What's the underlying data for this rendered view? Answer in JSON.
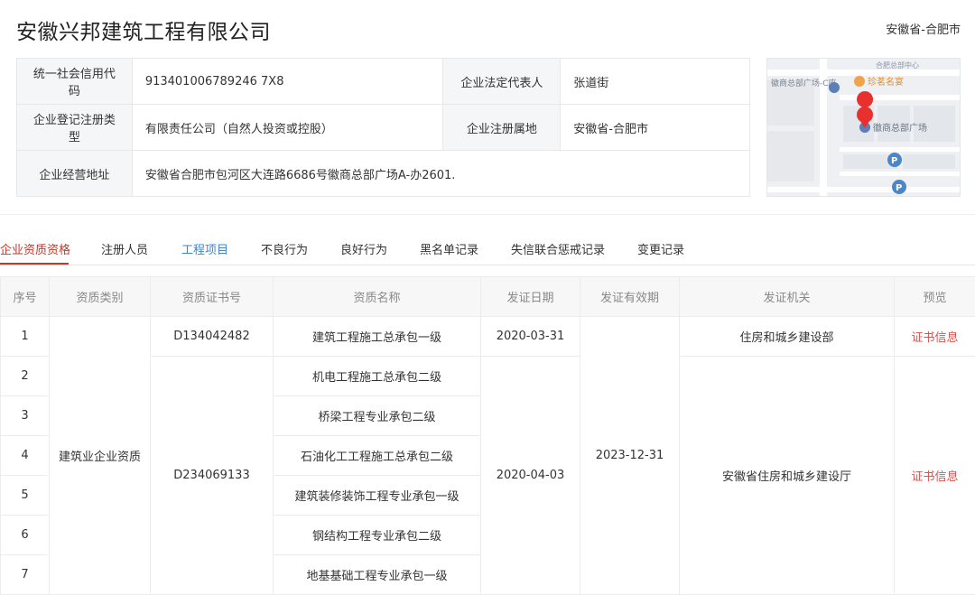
{
  "company": {
    "name": "安徽兴邦建筑工程有限公司",
    "region": "安徽省-合肥市"
  },
  "info": {
    "credit_code_label": "统一社会信用代码",
    "credit_code": "913401006789246 7X8",
    "legal_rep_label": "企业法定代表人",
    "legal_rep": "张道街",
    "reg_type_label": "企业登记注册类型",
    "reg_type": "有限责任公司（自然人投资或控股）",
    "reg_place_label": "企业注册属地",
    "reg_place": "安徽省-合肥市",
    "address_label": "企业经营地址",
    "address": "安徽省合肥市包河区大连路6686号徽商总部广场A-办2601."
  },
  "map": {
    "label_plaza_c": "徽商总部广场-C座",
    "label_plaza": "徽商总部广场",
    "label_restaurant": "珍茗名宴",
    "label_top": "合肥总部中心"
  },
  "tabs": [
    {
      "label": "企业资质资格"
    },
    {
      "label": "注册人员"
    },
    {
      "label": "工程项目"
    },
    {
      "label": "不良行为"
    },
    {
      "label": "良好行为"
    },
    {
      "label": "黑名单记录"
    },
    {
      "label": "失信联合惩戒记录"
    },
    {
      "label": "变更记录"
    }
  ],
  "table": {
    "headers": [
      "序号",
      "资质类别",
      "资质证书号",
      "资质名称",
      "发证日期",
      "发证有效期",
      "发证机关",
      "预览"
    ],
    "category": "建筑业企业资质",
    "validity": "2023-12-31",
    "rows": [
      {
        "no": "1",
        "cert_no": "D134042482",
        "name": "建筑工程施工总承包一级",
        "date": "2020-03-31",
        "authority": "住房和城乡建设部",
        "preview": "证书信息"
      },
      {
        "no": "2",
        "name": "机电工程施工总承包二级"
      },
      {
        "no": "3",
        "name": "桥梁工程专业承包二级"
      },
      {
        "no": "4",
        "name": "石油化工工程施工总承包二级"
      },
      {
        "no": "5",
        "name": "建筑装修装饰工程专业承包一级"
      },
      {
        "no": "6",
        "name": "钢结构工程专业承包二级"
      },
      {
        "no": "7",
        "name": "地基基础工程专业承包一级"
      }
    ],
    "group2": {
      "cert_no": "D234069133",
      "date": "2020-04-03",
      "authority": "安徽省住房和城乡建设厅",
      "preview": "证书信息"
    }
  }
}
